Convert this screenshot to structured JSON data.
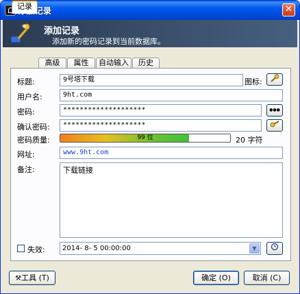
{
  "window": {
    "title": "添加记录",
    "close": "✕"
  },
  "banner": {
    "title": "添加记录",
    "subtitle": "添加新的密码记录到当前数据库。"
  },
  "tabs": [
    "记录",
    "高级",
    "属性",
    "自动输入",
    "历史"
  ],
  "form": {
    "title_label": "标题:",
    "title_value": "9号塔下载",
    "icon_label": "图标:",
    "username_label": "用户名:",
    "username_value": "9ht.com",
    "password_label": "密码:",
    "password_value": "********************",
    "password_toggle": "●●●",
    "repeat_label": "确认密码:",
    "repeat_value": "********************",
    "quality_label": "密码质量:",
    "quality_text": "99 位",
    "quality_fraction": 0.76,
    "quality_chars": "20 字符",
    "url_label": "网址:",
    "url_value": "www.9ht.com",
    "notes_label": "备注:",
    "notes_value": "下载链接",
    "expires_label": "失效:",
    "expires_value": "2014- 8- 5 00:00:00"
  },
  "footer": {
    "tools": "工具 (T)",
    "ok": "确定 (O)",
    "cancel": "取消 (C)"
  }
}
